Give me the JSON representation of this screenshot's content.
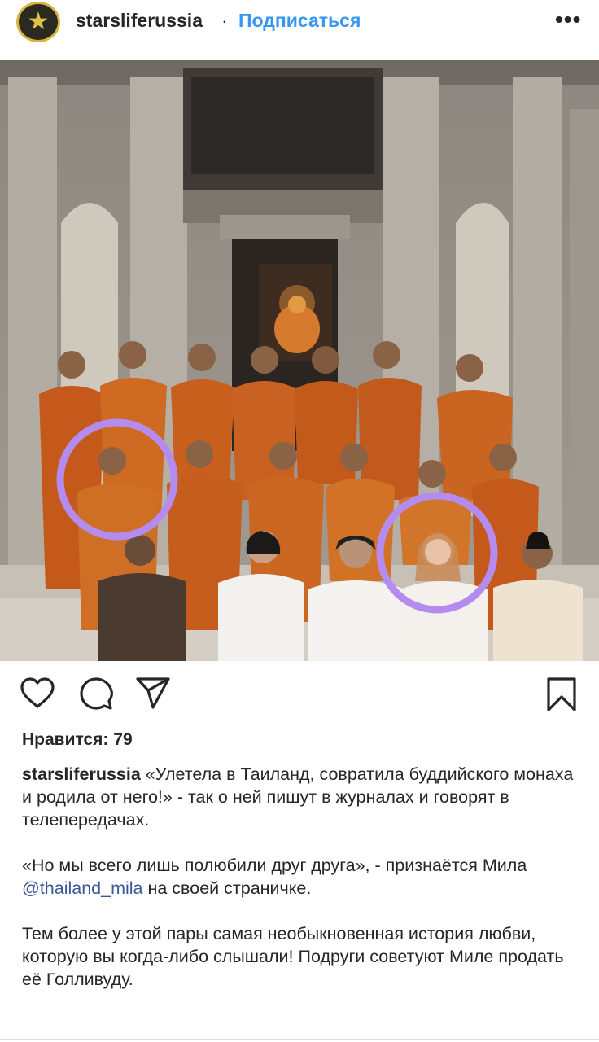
{
  "header": {
    "username": "starsliferussia",
    "separator": "·",
    "follow_label": "Подписаться",
    "more_label": "•••",
    "avatar_icon": "star-icon"
  },
  "photo": {
    "description_icon": "photo"
  },
  "actions": {
    "like_icon": "heart-icon",
    "comment_icon": "comment-icon",
    "share_icon": "share-icon",
    "save_icon": "bookmark-icon"
  },
  "likes": {
    "text": "Нравится: 79"
  },
  "caption": {
    "username": "starsliferussia",
    "p1": " «Улетела в Таиланд, совратила буддийского монаха и родила от него!» - так о ней пишут в журналах и говорят в телепередачах.",
    "p2_before": "«Но мы всего лишь полюбили друг друга», - признаётся Мила ",
    "p2_mention": "@thailand_mila",
    "p2_after": " на своей страничке.",
    "p3": "Тем более у этой пары самая необыкновенная история любви, которую вы когда-либо слышали!  Подруги советуют Миле продать её Голливуду."
  },
  "colors": {
    "follow": "#3897f0",
    "mention": "#385898",
    "robe": "#c8601e",
    "highlight_circle": "#b48cf0"
  }
}
